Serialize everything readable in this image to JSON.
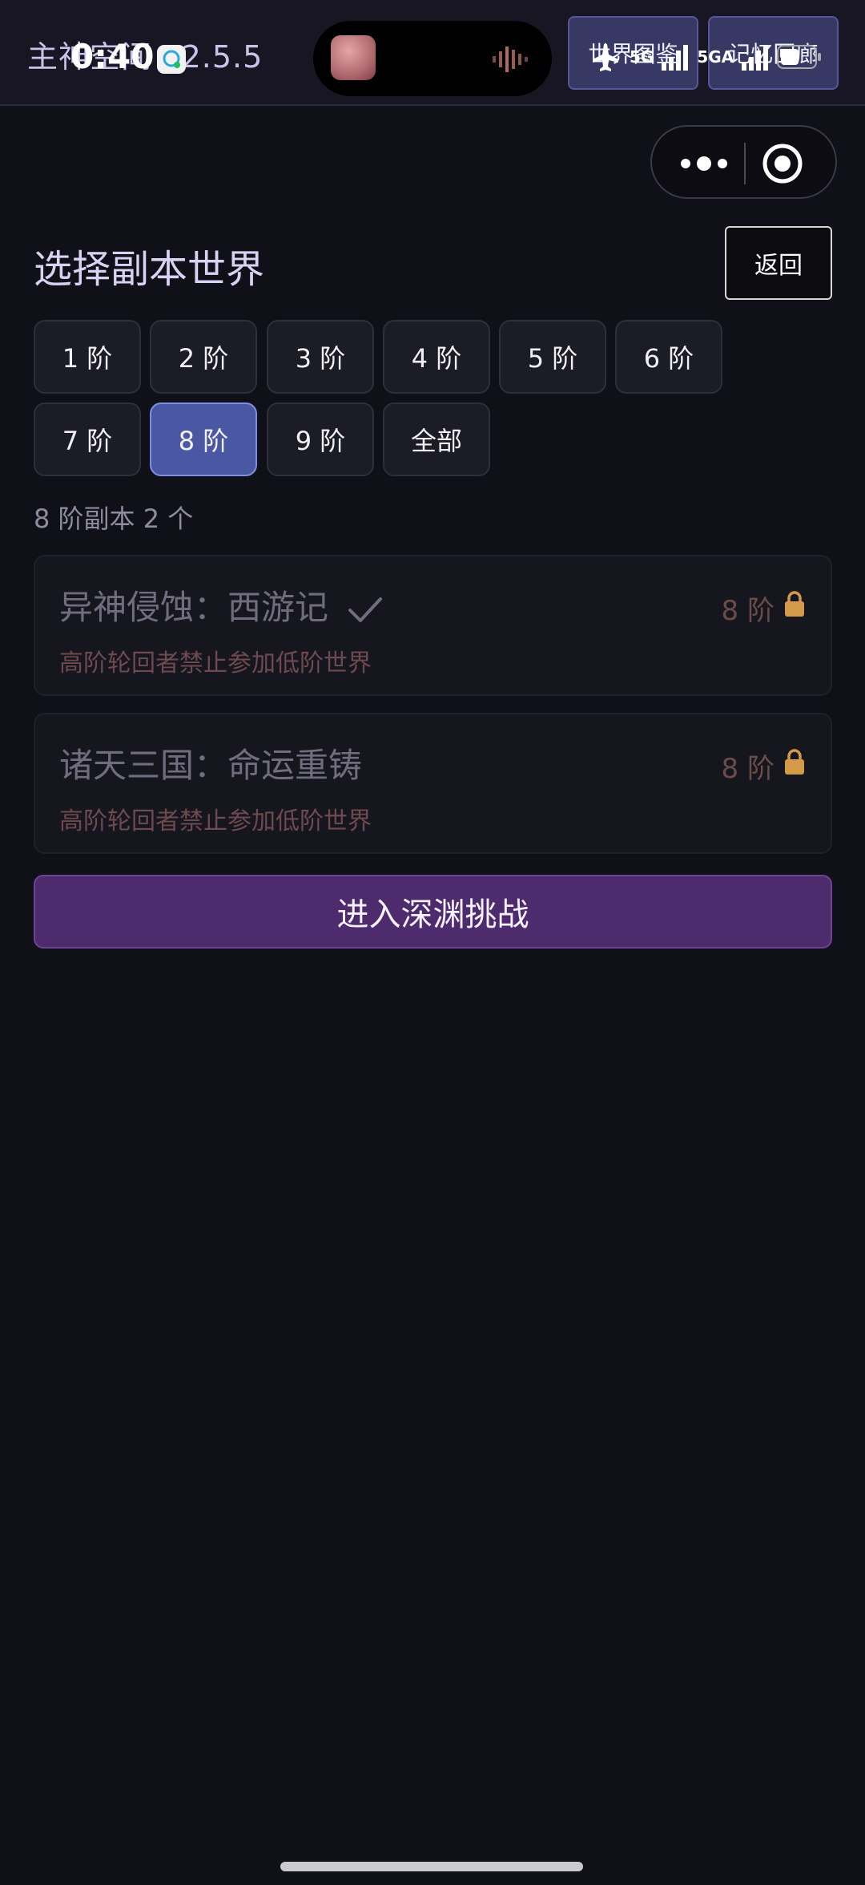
{
  "header": {
    "app_title": "主神空间 v2.5.5",
    "world_atlas_label": "世界图鉴",
    "memory_corridor_label": "记忆回廊"
  },
  "status_bar": {
    "time": "0:40",
    "network_1": "5G",
    "network_2": "5GA"
  },
  "page": {
    "title": "选择副本世界",
    "back_label": "返回"
  },
  "tiers": [
    {
      "label": "1 阶",
      "active": false
    },
    {
      "label": "2 阶",
      "active": false
    },
    {
      "label": "3 阶",
      "active": false
    },
    {
      "label": "4 阶",
      "active": false
    },
    {
      "label": "5 阶",
      "active": false
    },
    {
      "label": "6 阶",
      "active": false
    },
    {
      "label": "7 阶",
      "active": false
    },
    {
      "label": "8 阶",
      "active": true
    },
    {
      "label": "9 阶",
      "active": false
    },
    {
      "label": "全部",
      "active": false
    }
  ],
  "summary": "8 阶副本 2 个",
  "worlds": [
    {
      "title": "异神侵蚀：西游记",
      "completed": true,
      "tier": "8 阶",
      "locked": true,
      "note": "高阶轮回者禁止参加低阶世界"
    },
    {
      "title": "诸天三国：命运重铸",
      "completed": false,
      "tier": "8 阶",
      "locked": true,
      "note": "高阶轮回者禁止参加低阶世界"
    }
  ],
  "abyss_button_label": "进入深渊挑战",
  "colors": {
    "background": "#101019",
    "active_tier": "#4a58a3",
    "abyss_button": "#4d2b6c",
    "lock": "#d39a4a"
  },
  "icons": {
    "check": "check-icon",
    "lock": "lock-icon",
    "more": "more-dots-icon",
    "target": "target-icon"
  }
}
